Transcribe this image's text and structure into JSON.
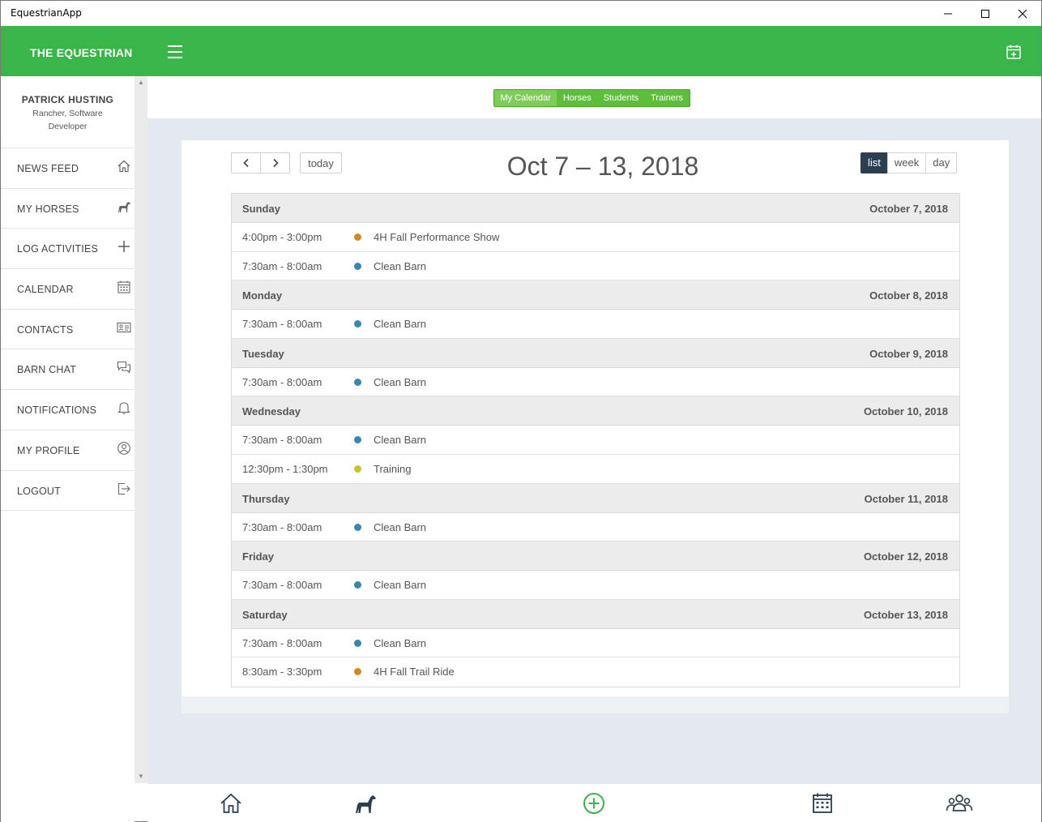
{
  "window": {
    "title": "EquestrianApp"
  },
  "header": {
    "brand": "THE EQUESTRIAN"
  },
  "profile": {
    "name": "PATRICK HUSTING",
    "role": "Rancher, Software Developer"
  },
  "sidebar": {
    "items": [
      {
        "label": "NEWS FEED",
        "icon": "home-icon"
      },
      {
        "label": "MY HORSES",
        "icon": "horse-icon"
      },
      {
        "label": "LOG ACTIVITIES",
        "icon": "plus-icon"
      },
      {
        "label": "CALENDAR",
        "icon": "calendar-icon"
      },
      {
        "label": "CONTACTS",
        "icon": "contact-card-icon"
      },
      {
        "label": "BARN CHAT",
        "icon": "chat-icon"
      },
      {
        "label": "NOTIFICATIONS",
        "icon": "bell-icon"
      },
      {
        "label": "MY PROFILE",
        "icon": "user-circle-icon"
      },
      {
        "label": "LOGOUT",
        "icon": "logout-icon"
      }
    ]
  },
  "subnav": {
    "tabs": [
      "My Calendar",
      "Horses",
      "Students",
      "Trainers"
    ],
    "active": "My Calendar"
  },
  "calendar": {
    "today_label": "today",
    "range_title": "Oct 7 – 13, 2018",
    "views": [
      "list",
      "week",
      "day"
    ],
    "active_view": "list",
    "days": [
      {
        "name": "Sunday",
        "date": "October 7, 2018",
        "events": [
          {
            "time": "4:00pm - 3:00pm",
            "title": "4H Fall Performance Show",
            "color": "#d4891f"
          },
          {
            "time": "7:30am - 8:00am",
            "title": "Clean Barn",
            "color": "#3a87ad"
          }
        ]
      },
      {
        "name": "Monday",
        "date": "October 8, 2018",
        "events": [
          {
            "time": "7:30am - 8:00am",
            "title": "Clean Barn",
            "color": "#3a87ad"
          }
        ]
      },
      {
        "name": "Tuesday",
        "date": "October 9, 2018",
        "events": [
          {
            "time": "7:30am - 8:00am",
            "title": "Clean Barn",
            "color": "#3a87ad"
          }
        ]
      },
      {
        "name": "Wednesday",
        "date": "October 10, 2018",
        "events": [
          {
            "time": "7:30am - 8:00am",
            "title": "Clean Barn",
            "color": "#3a87ad"
          },
          {
            "time": "12:30pm - 1:30pm",
            "title": "Training",
            "color": "#c4c62a"
          }
        ]
      },
      {
        "name": "Thursday",
        "date": "October 11, 2018",
        "events": [
          {
            "time": "7:30am - 8:00am",
            "title": "Clean Barn",
            "color": "#3a87ad"
          }
        ]
      },
      {
        "name": "Friday",
        "date": "October 12, 2018",
        "events": [
          {
            "time": "7:30am - 8:00am",
            "title": "Clean Barn",
            "color": "#3a87ad"
          }
        ]
      },
      {
        "name": "Saturday",
        "date": "October 13, 2018",
        "events": [
          {
            "time": "7:30am - 8:00am",
            "title": "Clean Barn",
            "color": "#3a87ad"
          },
          {
            "time": "8:30am - 3:30pm",
            "title": "4H Fall Trail Ride",
            "color": "#d4891f"
          }
        ]
      }
    ]
  },
  "bottom_nav": {
    "icons": [
      "home-icon",
      "horse-icon",
      "add-circle-icon",
      "calendar-icon",
      "group-icon"
    ]
  },
  "colors": {
    "header_green": "#3ab54a",
    "active_view": "#2c3e50",
    "segment_green": "#5cbe3a"
  }
}
